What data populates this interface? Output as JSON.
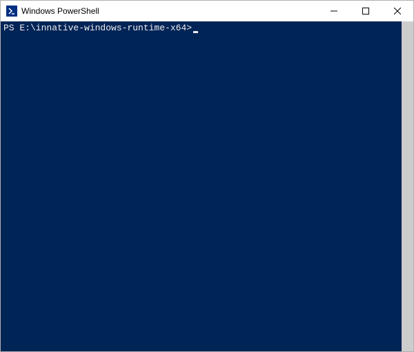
{
  "window": {
    "title": "Windows PowerShell"
  },
  "terminal": {
    "prompt": "PS E:\\innative-windows-runtime-x64>"
  }
}
